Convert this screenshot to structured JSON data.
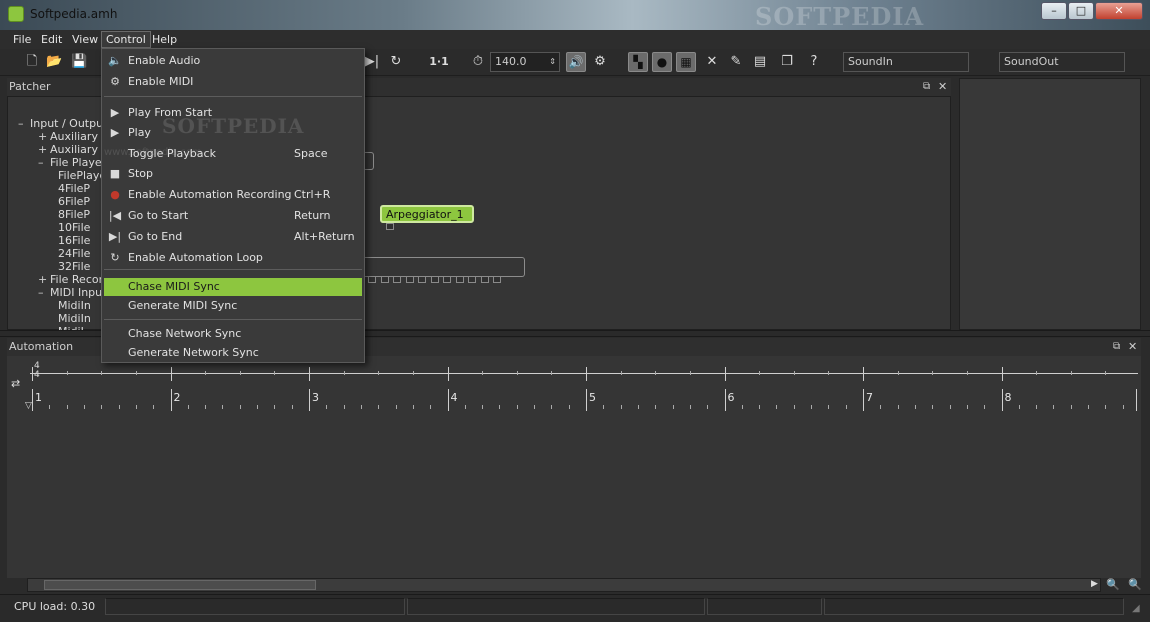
{
  "window": {
    "title": "Softpedia.amh",
    "watermark": "SOFTPEDIA",
    "controls": {
      "minimize": "–",
      "maximize": "□",
      "close": "✕"
    }
  },
  "menubar": {
    "items": [
      "File",
      "Edit",
      "View",
      "Control",
      "Help"
    ],
    "active": "Control"
  },
  "toolbar": {
    "ratio": "1·1",
    "tempo": "140.0",
    "sound_in": "SoundIn",
    "sound_out": "SoundOut"
  },
  "patcher": {
    "title": "Patcher",
    "tree": [
      {
        "toggle": "–",
        "label": "Input / Output"
      },
      {
        "toggle": "+",
        "label": "Auxiliary A"
      },
      {
        "toggle": "+",
        "label": "Auxiliary A"
      },
      {
        "toggle": "–",
        "label": "File Player"
      },
      {
        "toggle": "",
        "label": "FilePlayer"
      },
      {
        "toggle": "",
        "label": "4FileP"
      },
      {
        "toggle": "",
        "label": "6FileP"
      },
      {
        "toggle": "",
        "label": "8FileP"
      },
      {
        "toggle": "",
        "label": "10File"
      },
      {
        "toggle": "",
        "label": "16File"
      },
      {
        "toggle": "",
        "label": "24File"
      },
      {
        "toggle": "",
        "label": "32File"
      },
      {
        "toggle": "+",
        "label": "File Recor"
      },
      {
        "toggle": "–",
        "label": "MIDI Input"
      },
      {
        "toggle": "",
        "label": "MidiIn"
      },
      {
        "toggle": "",
        "label": "MidiIn"
      },
      {
        "toggle": "",
        "label": "MidiI"
      }
    ],
    "nodes": {
      "arpeggiator": "Arpeggiator_1"
    }
  },
  "automation": {
    "title": "Automation",
    "time_signature": {
      "numerator": "4",
      "denominator": "4"
    },
    "bars": [
      "1",
      "2",
      "3",
      "4",
      "5",
      "6",
      "7",
      "8"
    ]
  },
  "control_menu": {
    "items": [
      {
        "icon": "speaker-icon",
        "glyph": "🔈",
        "label": "Enable Audio",
        "shortcut": ""
      },
      {
        "icon": "midi-icon",
        "glyph": "⚙",
        "label": "Enable MIDI",
        "shortcut": ""
      },
      {
        "icon": "play-from-start-icon",
        "glyph": "▶",
        "label": "Play From Start",
        "shortcut": ""
      },
      {
        "icon": "play-icon",
        "glyph": "▶",
        "label": "Play",
        "shortcut": ""
      },
      {
        "icon": "",
        "glyph": "",
        "label": "Toggle Playback",
        "shortcut": "Space"
      },
      {
        "icon": "stop-icon",
        "glyph": "■",
        "label": "Stop",
        "shortcut": ""
      },
      {
        "icon": "record-icon",
        "glyph": "●",
        "label": "Enable Automation Recording",
        "shortcut": "Ctrl+R"
      },
      {
        "icon": "go-to-start-icon",
        "glyph": "|◀",
        "label": "Go to Start",
        "shortcut": "Return"
      },
      {
        "icon": "go-to-end-icon",
        "glyph": "▶|",
        "label": "Go to End",
        "shortcut": "Alt+Return"
      },
      {
        "icon": "loop-icon",
        "glyph": "↻",
        "label": "Enable Automation Loop",
        "shortcut": ""
      },
      {
        "icon": "",
        "glyph": "",
        "label": "Chase MIDI Sync",
        "shortcut": ""
      },
      {
        "icon": "",
        "glyph": "",
        "label": "Generate MIDI Sync",
        "shortcut": ""
      },
      {
        "icon": "",
        "glyph": "",
        "label": "Chase Network Sync",
        "shortcut": ""
      },
      {
        "icon": "",
        "glyph": "",
        "label": "Generate Network Sync",
        "shortcut": ""
      }
    ],
    "highlighted": "Chase MIDI Sync",
    "watermark": "SOFTPEDIA",
    "watermark_url": "www.softpedia.com"
  },
  "statusbar": {
    "cpu": "CPU load: 0.30"
  },
  "colors": {
    "accent": "#8dc63f",
    "background": "#2b2b2b"
  }
}
